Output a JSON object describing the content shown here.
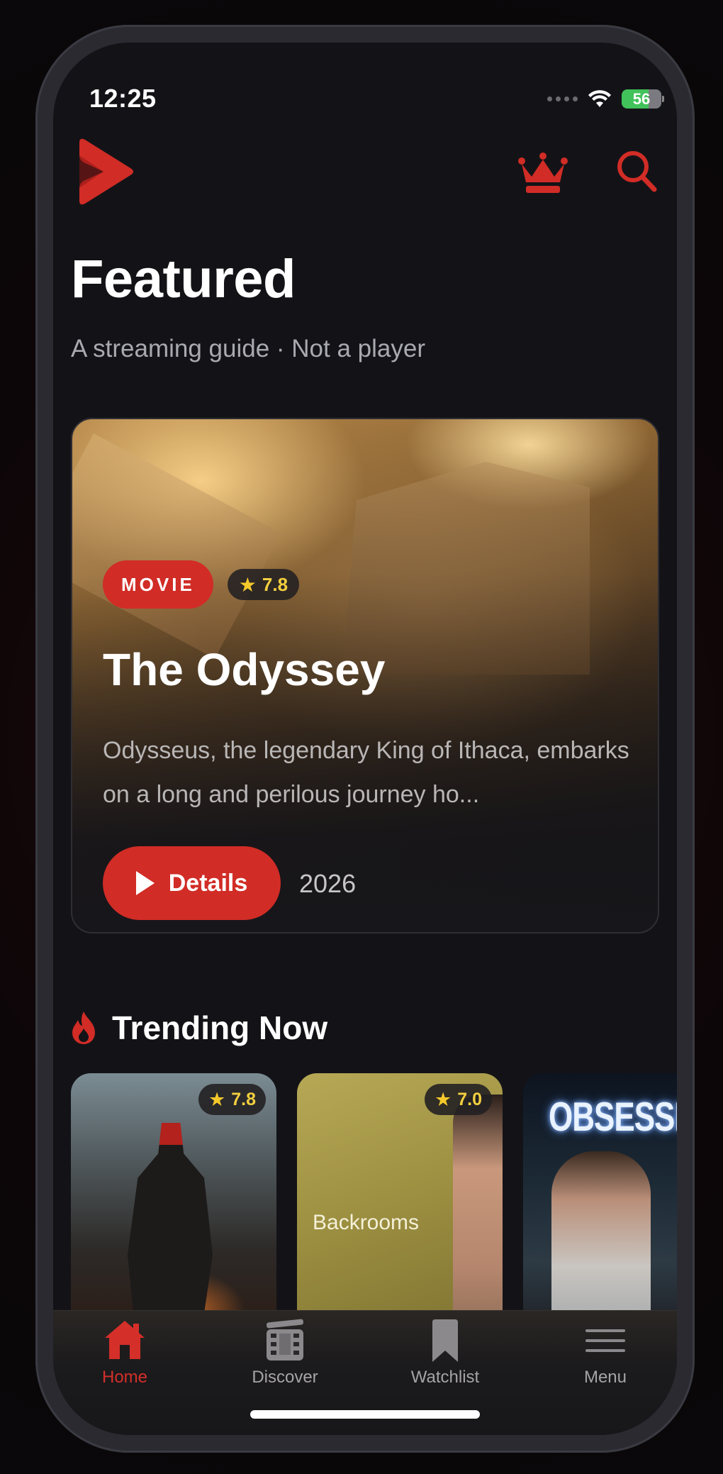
{
  "status_bar": {
    "time": "12:25",
    "battery": "56"
  },
  "header": {
    "title": "Featured",
    "subtitle": "A streaming guide · Not a player"
  },
  "hero": {
    "type_badge": "MOVIE",
    "rating": "7.8",
    "title": "The Odyssey",
    "description": "Odysseus, the legendary King of Ithaca, embarks on a long and perilous journey ho...",
    "button_label": "Details",
    "year": "2026"
  },
  "trending": {
    "title": "Trending Now",
    "items": [
      {
        "rating": "7.8",
        "poster_text": ""
      },
      {
        "rating": "7.0",
        "poster_text": "Backrooms"
      },
      {
        "rating": "",
        "poster_text": "OBSESSIO"
      }
    ]
  },
  "tabs": [
    {
      "label": "Home",
      "icon": "home-icon",
      "active": true
    },
    {
      "label": "Discover",
      "icon": "film-icon",
      "active": false
    },
    {
      "label": "Watchlist",
      "icon": "bookmark-icon",
      "active": false
    },
    {
      "label": "Menu",
      "icon": "menu-icon",
      "active": false
    }
  ],
  "colors": {
    "accent": "#d12c26",
    "background": "#131317",
    "star": "#f6c92b"
  }
}
